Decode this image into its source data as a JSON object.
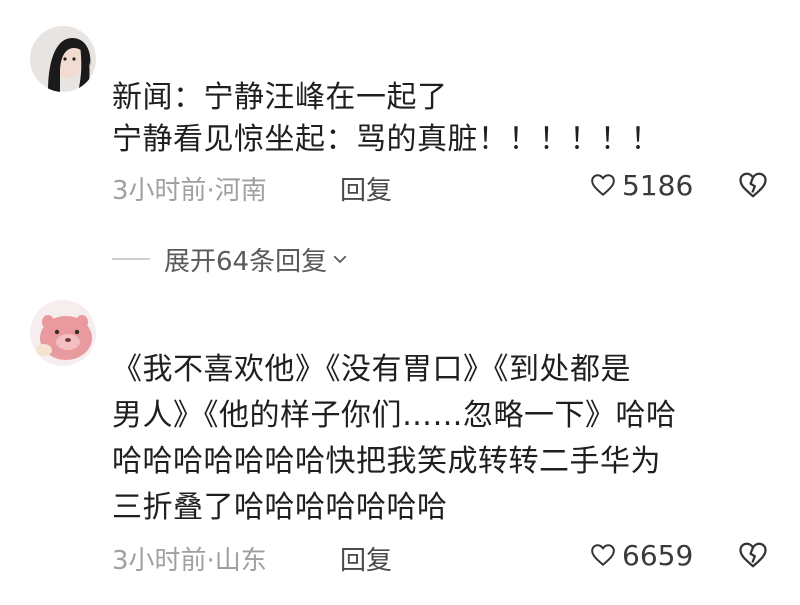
{
  "comments": [
    {
      "lines": [
        "新闻：宁静汪峰在一起了",
        "宁静看见惊坐起：骂的真脏！！！！！！"
      ],
      "time_location": "3小时前·河南",
      "reply_label": "回复",
      "likes": "5186",
      "expand_replies_label": "展开64条回复"
    },
    {
      "lines": [
        "《我不喜欢他》《没有胃口》《到处都是",
        "男人》《他的样子你们……忽略一下》哈哈",
        "哈哈哈哈哈哈哈快把我笑成转转二手华为",
        "三折叠了哈哈哈哈哈哈哈"
      ],
      "time_location": "3小时前·山东",
      "reply_label": "回复",
      "likes": "6659"
    }
  ],
  "icons": {
    "like": "heart-outline-icon",
    "dislike": "broken-heart-icon",
    "expand": "chevron-down-icon"
  },
  "colors": {
    "text": "#1f1f1f",
    "meta": "#a0a0a0",
    "reply": "#4a4a4a",
    "background": "#ffffff"
  }
}
